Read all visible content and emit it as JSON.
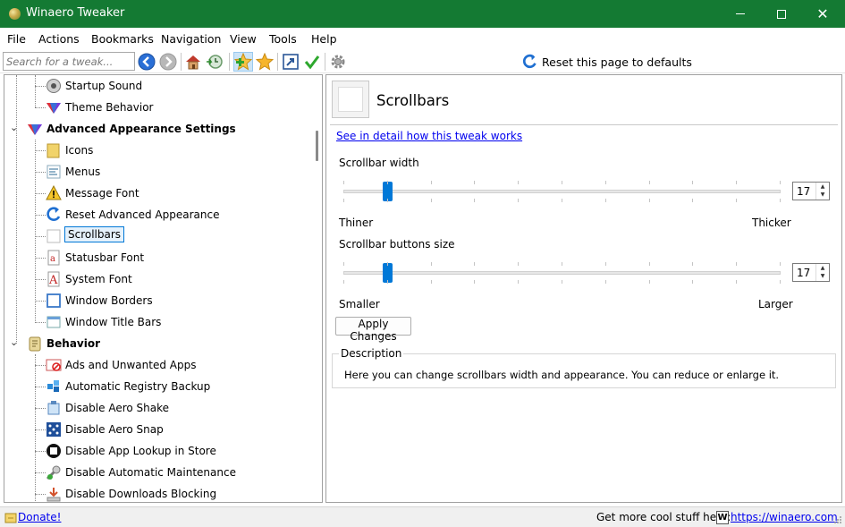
{
  "window": {
    "title": "Winaero Tweaker"
  },
  "menu": [
    "File",
    "Actions",
    "Bookmarks",
    "Navigation",
    "View",
    "Tools",
    "Help"
  ],
  "toolbar": {
    "search_placeholder": "Search for a tweak...",
    "reset_label": "Reset this page to defaults",
    "icons": [
      "back-icon",
      "forward-icon",
      "home-icon",
      "history-icon",
      "add-bookmark-icon",
      "bookmark-star-icon",
      "shortcut-icon",
      "apply-check-icon",
      "settings-gear-icon"
    ]
  },
  "tree": [
    {
      "label": "Startup Sound",
      "level": 1,
      "icon": "speaker-icon"
    },
    {
      "label": "Theme Behavior",
      "level": 1,
      "icon": "theme-icon"
    },
    {
      "label": "Advanced Appearance Settings",
      "level": 0,
      "icon": "appearance-icon",
      "expanded": true
    },
    {
      "label": "Icons",
      "level": 1,
      "icon": "folder-icon"
    },
    {
      "label": "Menus",
      "level": 1,
      "icon": "menu-icon"
    },
    {
      "label": "Message Font",
      "level": 1,
      "icon": "warning-icon"
    },
    {
      "label": "Reset Advanced Appearance",
      "level": 1,
      "icon": "reset-icon"
    },
    {
      "label": "Scrollbars",
      "level": 1,
      "icon": "scrollbar-icon",
      "selected": true
    },
    {
      "label": "Statusbar Font",
      "level": 1,
      "icon": "font-icon"
    },
    {
      "label": "System Font",
      "level": 1,
      "icon": "font-a-icon"
    },
    {
      "label": "Window Borders",
      "level": 1,
      "icon": "window-border-icon"
    },
    {
      "label": "Window Title Bars",
      "level": 1,
      "icon": "title-bar-icon"
    },
    {
      "label": "Behavior",
      "level": 0,
      "icon": "behavior-icon",
      "expanded": true
    },
    {
      "label": "Ads and Unwanted Apps",
      "level": 1,
      "icon": "no-ads-icon"
    },
    {
      "label": "Automatic Registry Backup",
      "level": 1,
      "icon": "registry-icon"
    },
    {
      "label": "Disable Aero Shake",
      "level": 1,
      "icon": "shake-icon"
    },
    {
      "label": "Disable Aero Snap",
      "level": 1,
      "icon": "snap-icon"
    },
    {
      "label": "Disable App Lookup in Store",
      "level": 1,
      "icon": "store-icon"
    },
    {
      "label": "Disable Automatic Maintenance",
      "level": 1,
      "icon": "maintenance-icon"
    },
    {
      "label": "Disable Downloads Blocking",
      "level": 1,
      "icon": "download-icon"
    }
  ],
  "page": {
    "title": "Scrollbars",
    "detail_link": "See in detail how this tweak works",
    "width": {
      "label": "Scrollbar width",
      "value": "17",
      "min_label": "Thiner",
      "max_label": "Thicker",
      "position": 0.1
    },
    "buttons": {
      "label": "Scrollbar buttons size",
      "value": "17",
      "min_label": "Smaller",
      "max_label": "Larger",
      "position": 0.1
    },
    "apply_label": "Apply Changes",
    "description_title": "Description",
    "description_text": "Here you can change scrollbars width and appearance. You can reduce or enlarge it."
  },
  "status": {
    "donate": "Donate!",
    "get_more": "Get more cool stuff here:",
    "logo_letter": "W",
    "site": "https://winaero.com"
  }
}
